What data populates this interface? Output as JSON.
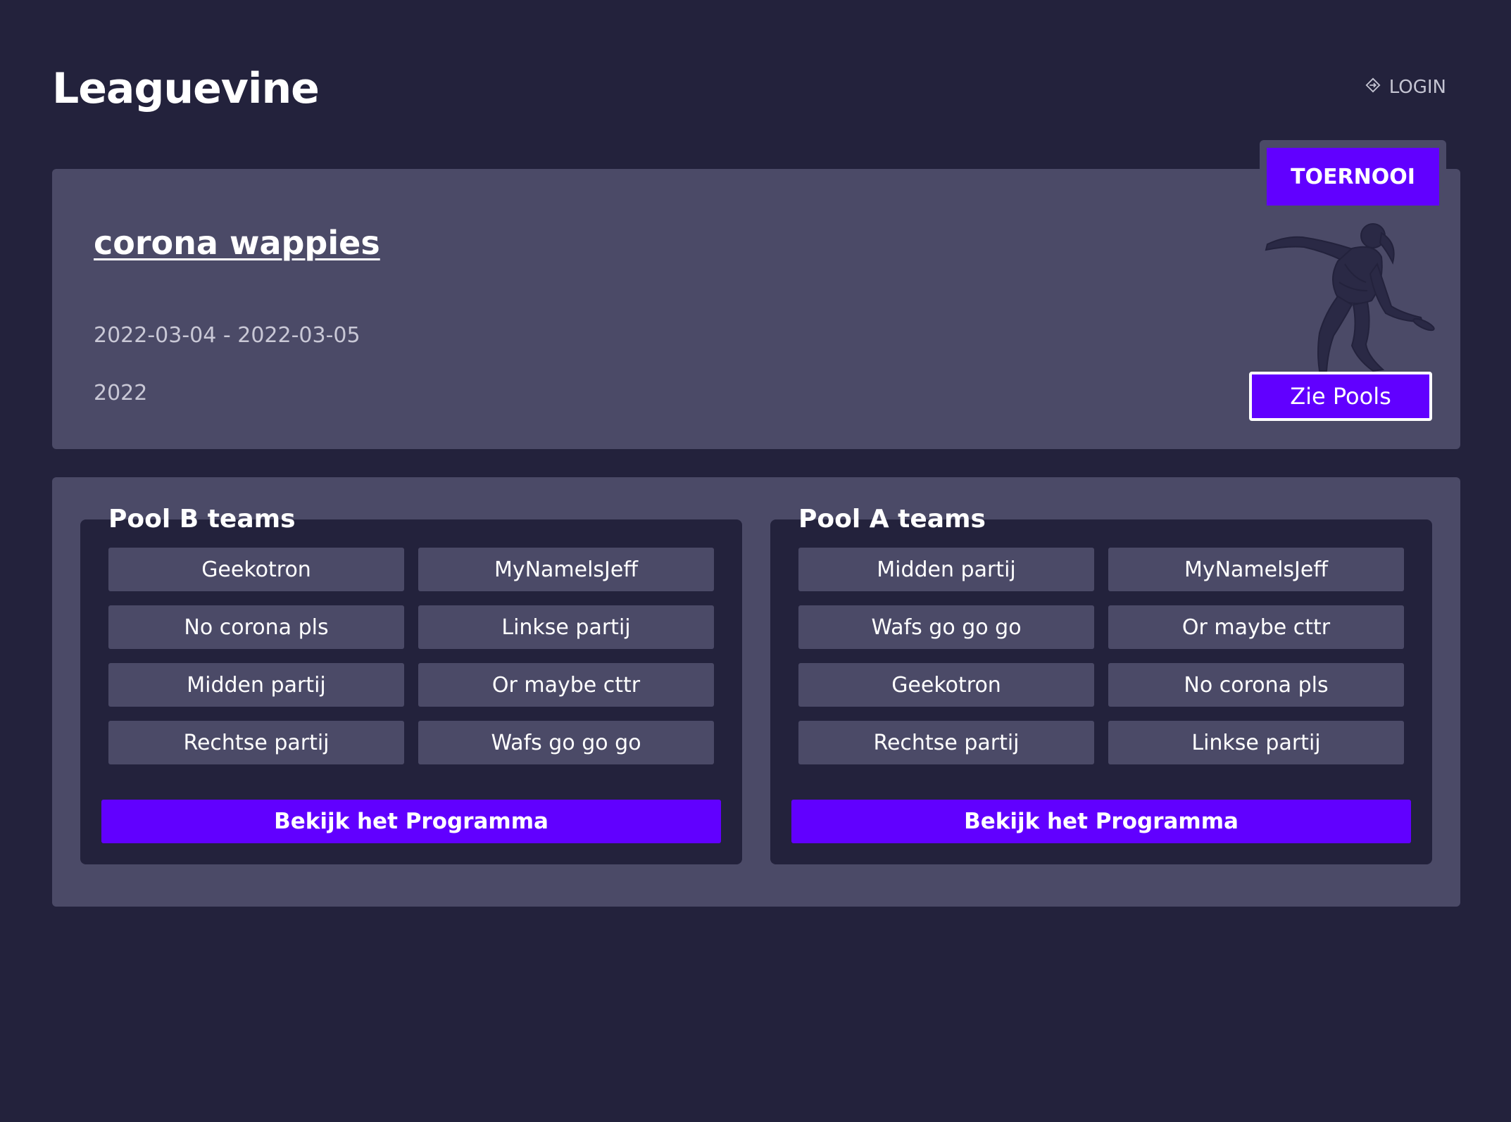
{
  "header": {
    "logo": "Leaguevine",
    "login_label": "LOGIN"
  },
  "tournament": {
    "badge": "TOERNOOI",
    "title": "corona wappies",
    "dates": "2022-03-04 - 2022-03-05",
    "year": "2022",
    "see_pools_label": "Zie Pools"
  },
  "pools": [
    {
      "heading": "Pool B teams",
      "teams": [
        "Geekotron",
        "MyNamelsJeff",
        "No corona pls",
        "Linkse partij",
        "Midden partij",
        "Or maybe cttr",
        "Rechtse partij",
        "Wafs go go go"
      ],
      "button_label": "Bekijk het Programma"
    },
    {
      "heading": "Pool A teams",
      "teams": [
        "Midden partij",
        "MyNamelsJeff",
        "Wafs go go go",
        "Or maybe cttr",
        "Geekotron",
        "No corona pls",
        "Rechtse partij",
        "Linkse partij"
      ],
      "button_label": "Bekijk het Programma"
    }
  ],
  "colors": {
    "background": "#23223c",
    "card": "#4b4a67",
    "accent": "#6100ff"
  }
}
